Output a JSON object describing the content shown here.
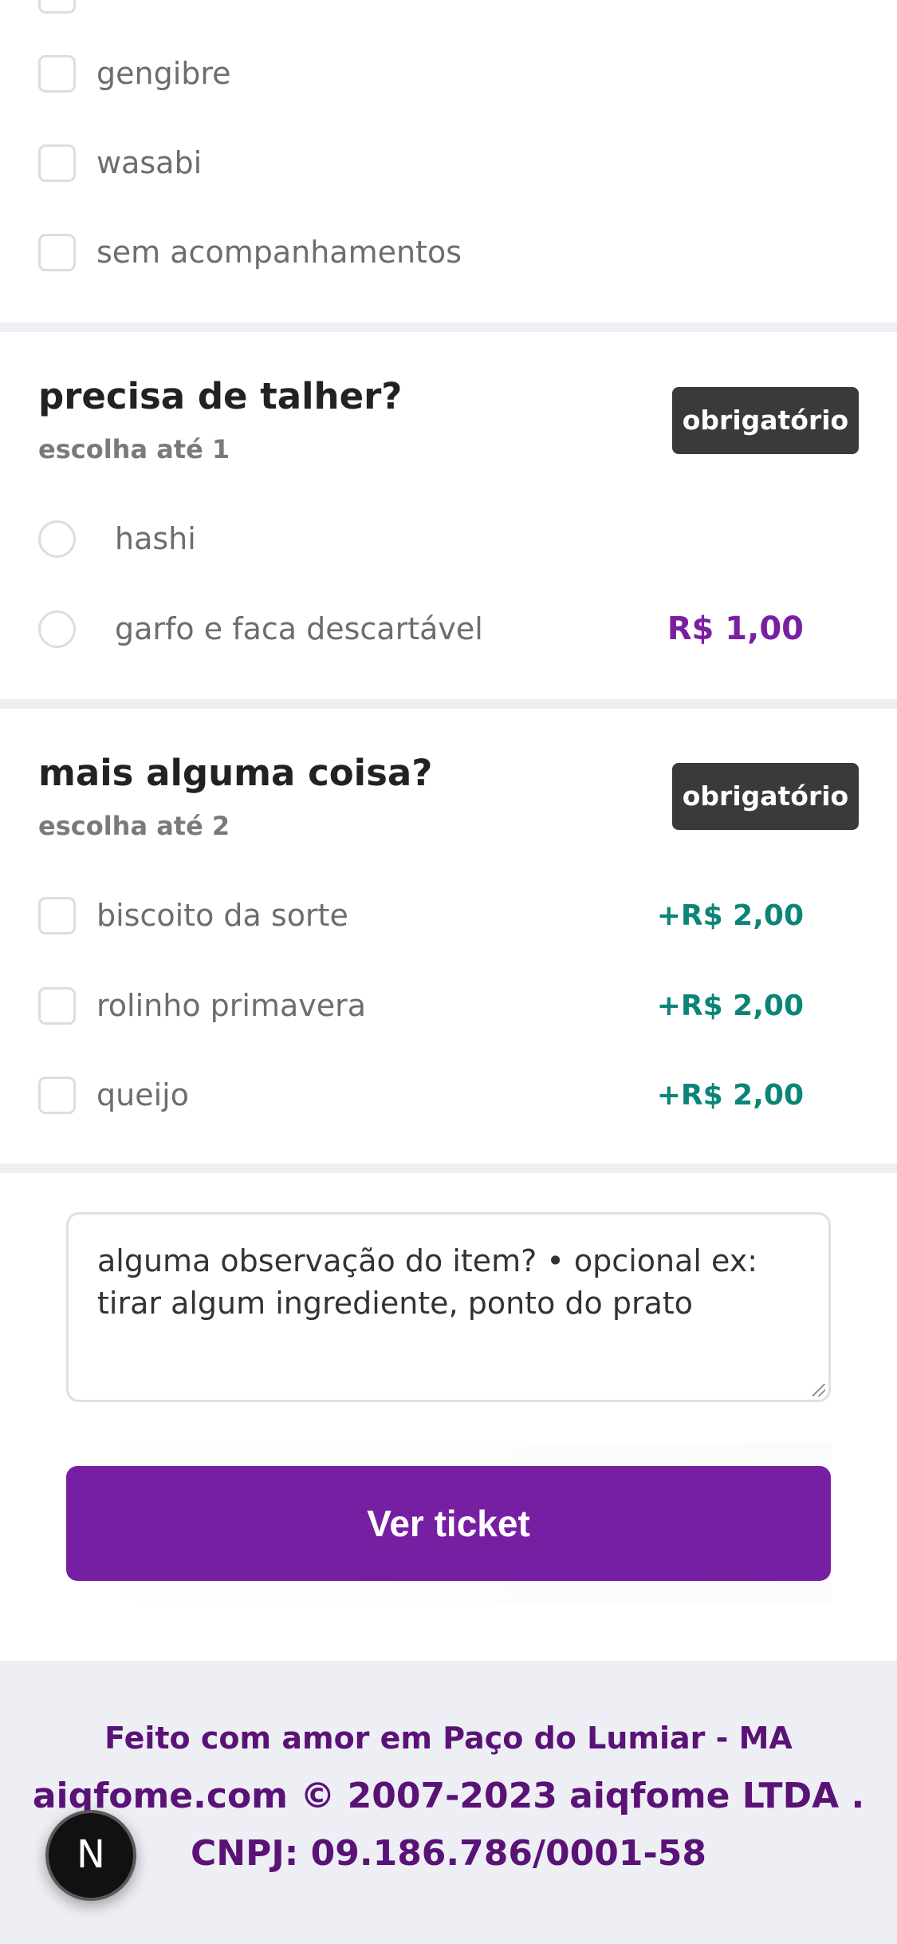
{
  "acompanhamentos": {
    "items": [
      {
        "label": "gengibre"
      },
      {
        "label": "wasabi"
      },
      {
        "label": "sem acompanhamentos"
      }
    ]
  },
  "talher": {
    "title": "precisa de talher?",
    "subtitle": "escolha até 1",
    "badge": "obrigatório",
    "items": [
      {
        "label": "hashi",
        "price": ""
      },
      {
        "label": "garfo e faca descartável",
        "price": "R$ 1,00"
      }
    ]
  },
  "mais": {
    "title": "mais alguma coisa?",
    "subtitle": "escolha até 2",
    "badge": "obrigatório",
    "items": [
      {
        "label": "biscoito da sorte",
        "price": "+R$ 2,00"
      },
      {
        "label": "rolinho primavera",
        "price": "+R$ 2,00"
      },
      {
        "label": "queijo",
        "price": "+R$ 2,00"
      }
    ]
  },
  "observacao": {
    "placeholder": "alguma observação do item? • opcional ex: tirar algum ingrediente, ponto do prato"
  },
  "action": {
    "button_label": "Ver ticket"
  },
  "footer": {
    "line1": "Feito com amor em Paço do Lumiar - MA",
    "line2": "aiqfome.com © 2007-2023 aiqfome LTDA .",
    "line3": "CNPJ: 09.186.786/0001-58"
  },
  "dev_badge": {
    "letter": "N",
    "icon": "nextjs-icon"
  },
  "colors": {
    "brand": "#771fa3",
    "price_purple": "#7b1fa2",
    "price_teal": "#0b8577",
    "badge_bg": "#3a3a3a",
    "footer_text": "#5a1276"
  }
}
